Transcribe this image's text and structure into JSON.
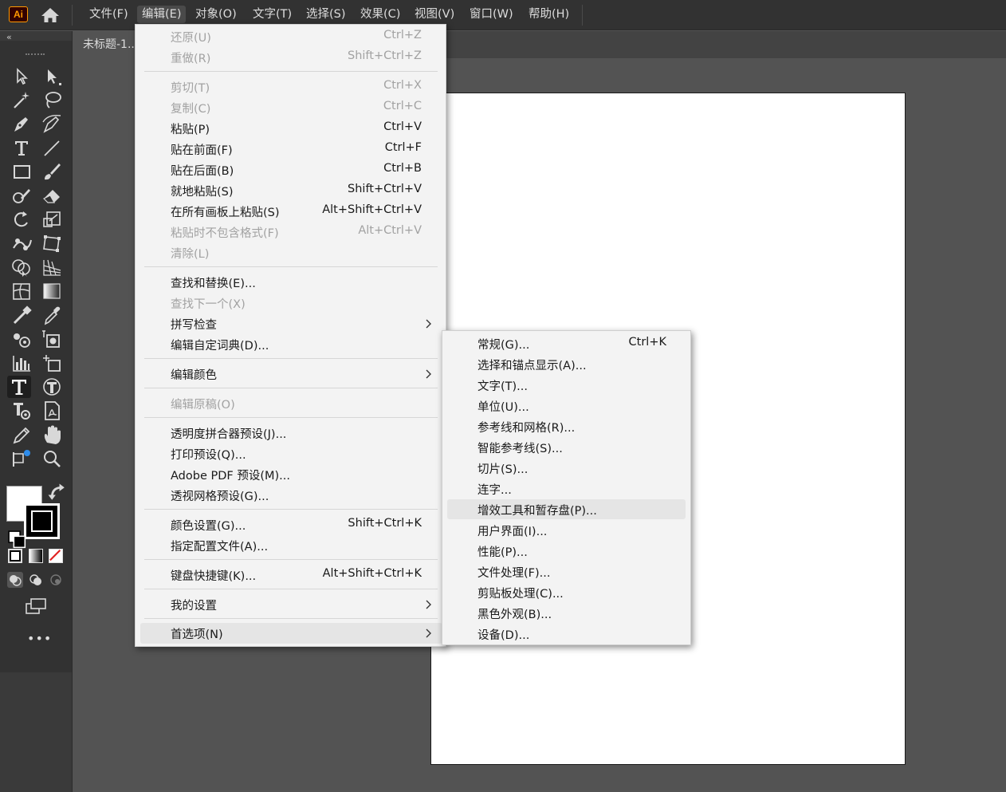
{
  "app": {
    "logo_text": "Ai"
  },
  "menubar": {
    "items": [
      {
        "label": "文件(F)",
        "active": false
      },
      {
        "label": "编辑(E)",
        "active": true
      },
      {
        "label": "对象(O)",
        "active": false
      },
      {
        "label": "文字(T)",
        "active": false
      },
      {
        "label": "选择(S)",
        "active": false
      },
      {
        "label": "效果(C)",
        "active": false
      },
      {
        "label": "视图(V)",
        "active": false
      },
      {
        "label": "窗口(W)",
        "active": false
      },
      {
        "label": "帮助(H)",
        "active": false
      }
    ]
  },
  "document": {
    "tab_title": "未标题-1..."
  },
  "toolbar": {
    "collapse_glyph": "«",
    "more_glyph": "•••",
    "tools": [
      "selection-tool-icon",
      "direct-selection-tool-icon",
      "magic-wand-tool-icon",
      "lasso-tool-icon",
      "pen-tool-icon",
      "curvature-tool-icon",
      "type-tool-icon",
      "line-segment-tool-icon",
      "rectangle-tool-icon",
      "paintbrush-tool-icon",
      "shaper-tool-icon",
      "eraser-tool-icon",
      "rotate-tool-icon",
      "scale-tool-icon",
      "puppet-warp-tool-icon",
      "free-transform-tool-icon",
      "shape-builder-tool-icon",
      "perspective-grid-tool-icon",
      "mesh-tool-icon",
      "gradient-tool-icon",
      "blend-tool-icon",
      "eyedropper-tool-icon",
      "symbol-sprayer-tool-icon",
      "live-paint-tool-icon",
      "column-graph-tool-icon",
      "artboard-tool-icon",
      "type-on-path-tool-icon",
      "touch-type-tool-icon",
      "text-import-tool-icon",
      "pdf-tool-icon",
      "pencil-tool-icon",
      "hand-tool-icon",
      "puppet-pin-tool-icon",
      "zoom-tool-icon"
    ],
    "selected_tool": "type-tool-icon",
    "colors": {
      "fill": "#ffffff",
      "stroke": "#000000",
      "panel_bg": "#323232",
      "accent_blue": "#2d8ceb"
    }
  },
  "edit_menu": {
    "items": [
      {
        "label": "还原(U)",
        "shortcut": "Ctrl+Z",
        "disabled": true
      },
      {
        "label": "重做(R)",
        "shortcut": "Shift+Ctrl+Z",
        "disabled": true
      },
      {
        "separator": true
      },
      {
        "label": "剪切(T)",
        "shortcut": "Ctrl+X",
        "disabled": true
      },
      {
        "label": "复制(C)",
        "shortcut": "Ctrl+C",
        "disabled": true
      },
      {
        "label": "粘贴(P)",
        "shortcut": "Ctrl+V",
        "disabled": false
      },
      {
        "label": "贴在前面(F)",
        "shortcut": "Ctrl+F",
        "disabled": false
      },
      {
        "label": "贴在后面(B)",
        "shortcut": "Ctrl+B",
        "disabled": false
      },
      {
        "label": "就地粘贴(S)",
        "shortcut": "Shift+Ctrl+V",
        "disabled": false
      },
      {
        "label": "在所有画板上粘贴(S)",
        "shortcut": "Alt+Shift+Ctrl+V",
        "disabled": false
      },
      {
        "label": "粘贴时不包含格式(F)",
        "shortcut": "Alt+Ctrl+V",
        "disabled": true
      },
      {
        "label": "清除(L)",
        "shortcut": "",
        "disabled": true
      },
      {
        "separator": true
      },
      {
        "label": "查找和替换(E)...",
        "shortcut": "",
        "disabled": false
      },
      {
        "label": "查找下一个(X)",
        "shortcut": "",
        "disabled": true
      },
      {
        "label": "拼写检查",
        "shortcut": "",
        "disabled": false,
        "submenu": true
      },
      {
        "label": "编辑自定词典(D)...",
        "shortcut": "",
        "disabled": false
      },
      {
        "separator": true
      },
      {
        "label": "编辑颜色",
        "shortcut": "",
        "disabled": false,
        "submenu": true
      },
      {
        "separator": true
      },
      {
        "label": "编辑原稿(O)",
        "shortcut": "",
        "disabled": true
      },
      {
        "separator": true
      },
      {
        "label": "透明度拼合器预设(J)...",
        "shortcut": "",
        "disabled": false
      },
      {
        "label": "打印预设(Q)...",
        "shortcut": "",
        "disabled": false
      },
      {
        "label": "Adobe PDF 预设(M)...",
        "shortcut": "",
        "disabled": false
      },
      {
        "label": "透视网格预设(G)...",
        "shortcut": "",
        "disabled": false
      },
      {
        "separator": true
      },
      {
        "label": "颜色设置(G)...",
        "shortcut": "Shift+Ctrl+K",
        "disabled": false
      },
      {
        "label": "指定配置文件(A)...",
        "shortcut": "",
        "disabled": false
      },
      {
        "separator": true
      },
      {
        "label": "键盘快捷键(K)...",
        "shortcut": "Alt+Shift+Ctrl+K",
        "disabled": false
      },
      {
        "separator": true
      },
      {
        "label": "我的设置",
        "shortcut": "",
        "disabled": false,
        "submenu": true
      },
      {
        "separator": true
      },
      {
        "label": "首选项(N)",
        "shortcut": "",
        "disabled": false,
        "submenu": true,
        "hover": true
      }
    ]
  },
  "preferences_submenu": {
    "items": [
      {
        "label": "常规(G)...",
        "shortcut": "Ctrl+K"
      },
      {
        "label": "选择和锚点显示(A)...",
        "shortcut": ""
      },
      {
        "label": "文字(T)...",
        "shortcut": ""
      },
      {
        "label": "单位(U)...",
        "shortcut": ""
      },
      {
        "label": "参考线和网格(R)...",
        "shortcut": ""
      },
      {
        "label": "智能参考线(S)...",
        "shortcut": ""
      },
      {
        "label": "切片(S)...",
        "shortcut": ""
      },
      {
        "label": "连字...",
        "shortcut": ""
      },
      {
        "label": "增效工具和暂存盘(P)...",
        "shortcut": "",
        "hover": true
      },
      {
        "label": "用户界面(I)...",
        "shortcut": ""
      },
      {
        "label": "性能(P)...",
        "shortcut": ""
      },
      {
        "label": "文件处理(F)...",
        "shortcut": ""
      },
      {
        "label": "剪贴板处理(C)...",
        "shortcut": ""
      },
      {
        "label": "黑色外观(B)...",
        "shortcut": ""
      },
      {
        "label": "设备(D)...",
        "shortcut": ""
      }
    ]
  }
}
